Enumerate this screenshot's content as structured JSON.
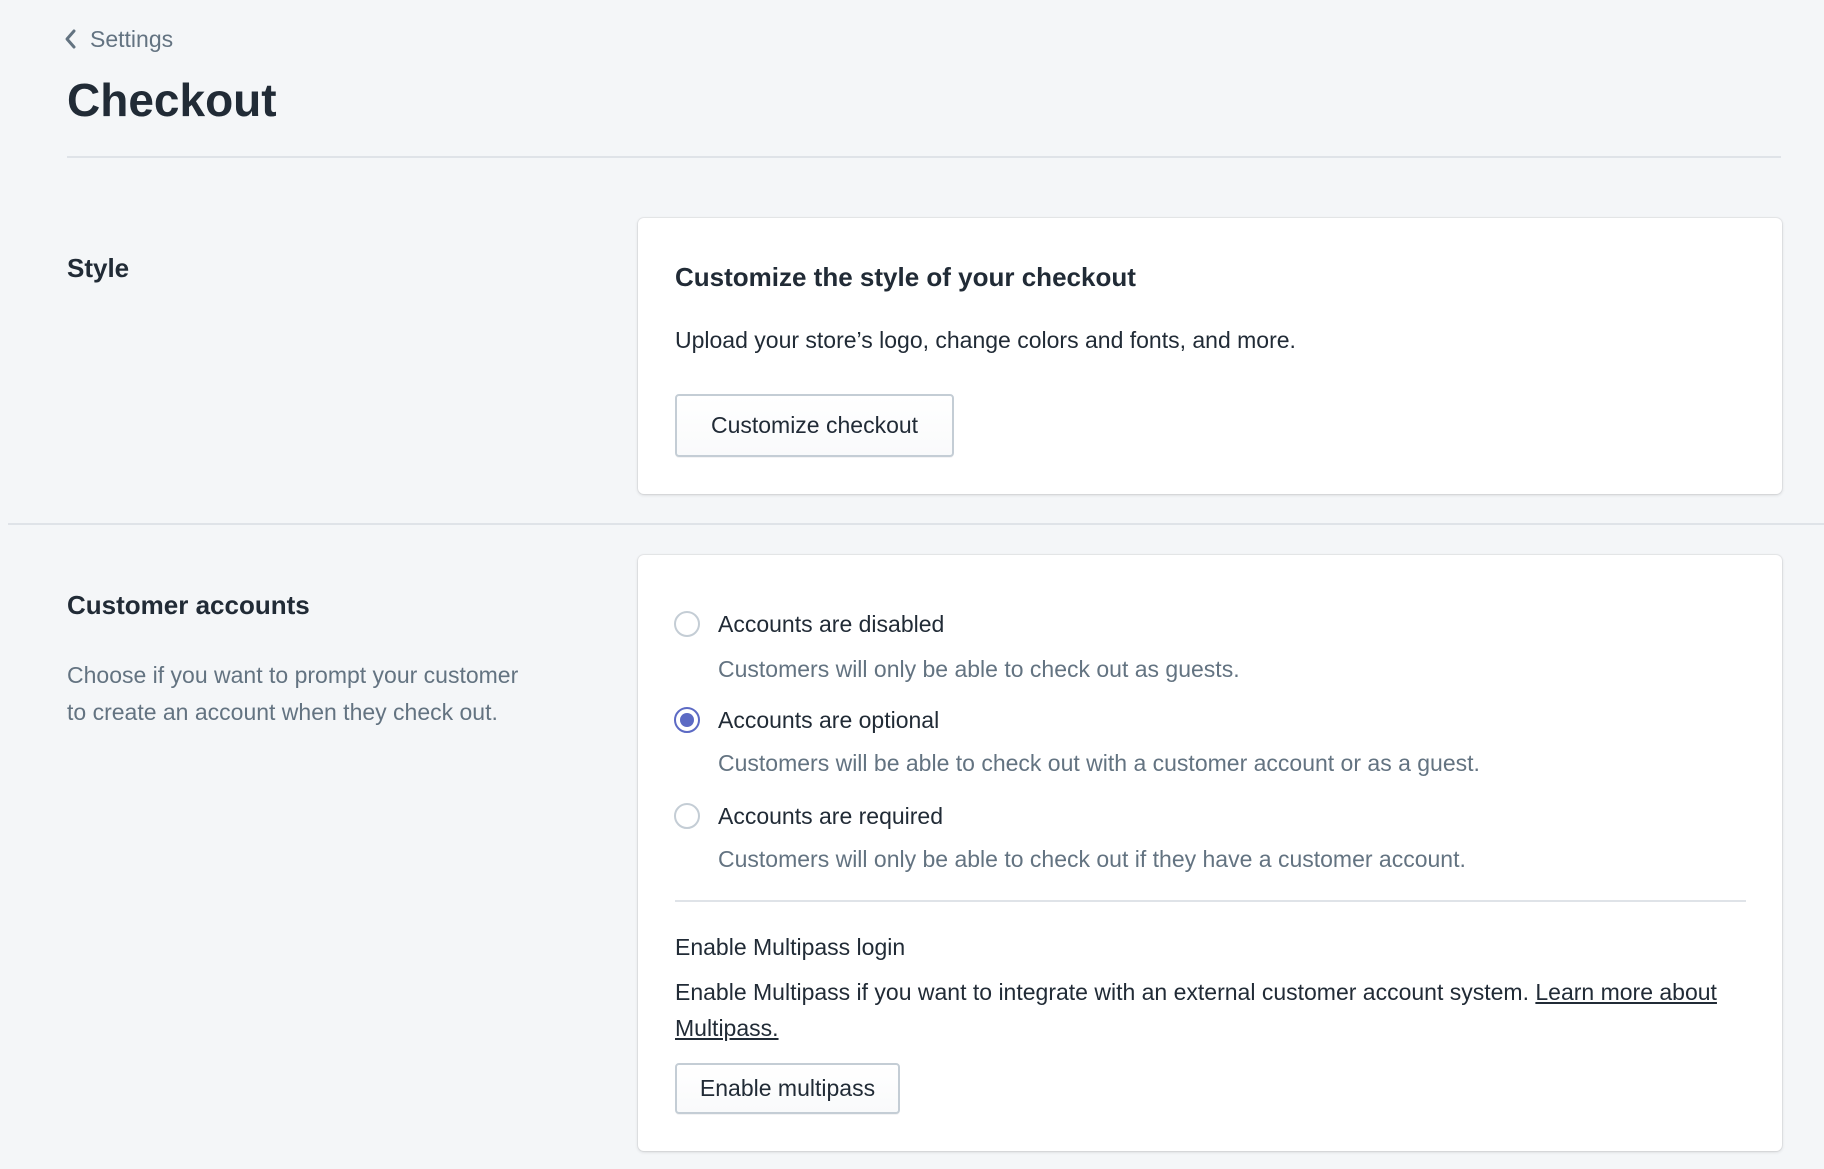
{
  "breadcrumb": {
    "label": "Settings",
    "icon": "chevron-left-icon"
  },
  "page": {
    "title": "Checkout"
  },
  "style_section": {
    "heading": "Style",
    "card_title": "Customize the style of your checkout",
    "card_text": "Upload your store’s logo, change colors and fonts, and more.",
    "button_label": "Customize checkout"
  },
  "accounts_section": {
    "heading": "Customer accounts",
    "description": "Choose if you want to prompt your customer to create an account when they check out.",
    "options": [
      {
        "label": "Accounts are disabled",
        "help": "Customers will only be able to check out as guests.",
        "checked": false
      },
      {
        "label": "Accounts are optional",
        "help": "Customers will be able to check out with a customer account or as a guest.",
        "checked": true
      },
      {
        "label": "Accounts are required",
        "help": "Customers will only be able to check out if they have a customer account.",
        "checked": false
      }
    ],
    "multipass": {
      "title": "Enable Multipass login",
      "text": "Enable Multipass if you want to integrate with an external customer account system.",
      "link_label": "Learn more about Multipass.",
      "button_label": "Enable multipass"
    }
  },
  "colors": {
    "background": "#f4f6f8",
    "accent": "#5c6ac4",
    "text": "#212b36",
    "subdued_text": "#637381",
    "border": "#c4cdd5"
  }
}
